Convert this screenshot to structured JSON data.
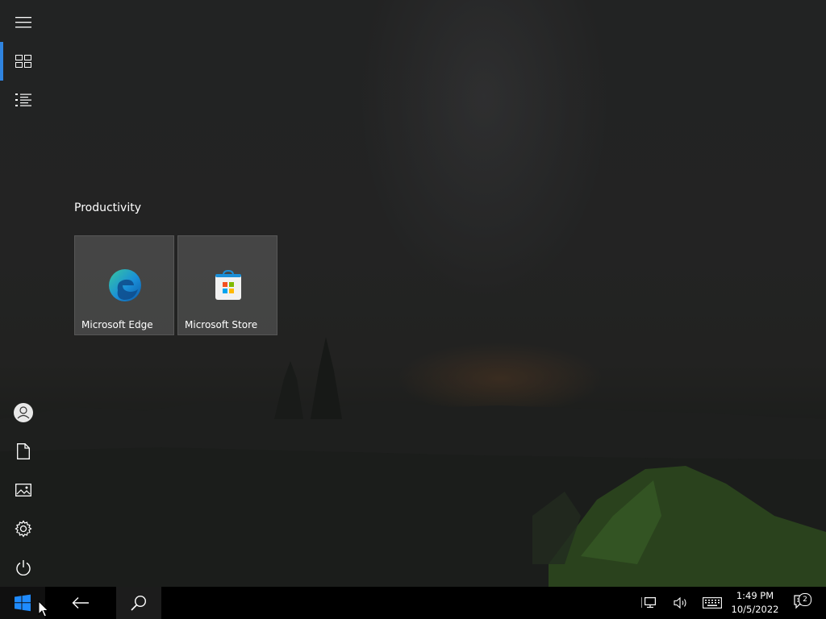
{
  "desktop": {
    "colors": {
      "accent": "#2f84e0",
      "taskbar": "#000000",
      "tile": "#5c5c5c"
    }
  },
  "start_menu": {
    "rail": {
      "top": [
        {
          "name": "hamburger-menu-icon",
          "active": false
        },
        {
          "name": "tiles-view-icon",
          "active": true
        },
        {
          "name": "all-apps-list-icon",
          "active": false
        }
      ],
      "bottom": [
        {
          "name": "user-account-icon"
        },
        {
          "name": "documents-icon"
        },
        {
          "name": "pictures-icon"
        },
        {
          "name": "settings-gear-icon"
        },
        {
          "name": "power-icon"
        }
      ]
    },
    "group_title": "Productivity",
    "tiles": [
      {
        "label": "Microsoft Edge",
        "icon": "edge-icon"
      },
      {
        "label": "Microsoft Store",
        "icon": "store-icon"
      }
    ]
  },
  "taskbar": {
    "start_icon": "windows-logo-icon",
    "back_icon": "back-arrow-icon",
    "search_icon": "search-icon",
    "tray": {
      "network_icon": "network-icon",
      "volume_icon": "volume-icon",
      "keyboard_icon": "touch-keyboard-icon",
      "time": "1:49 PM",
      "date": "10/5/2022",
      "notification_count": "2"
    }
  }
}
